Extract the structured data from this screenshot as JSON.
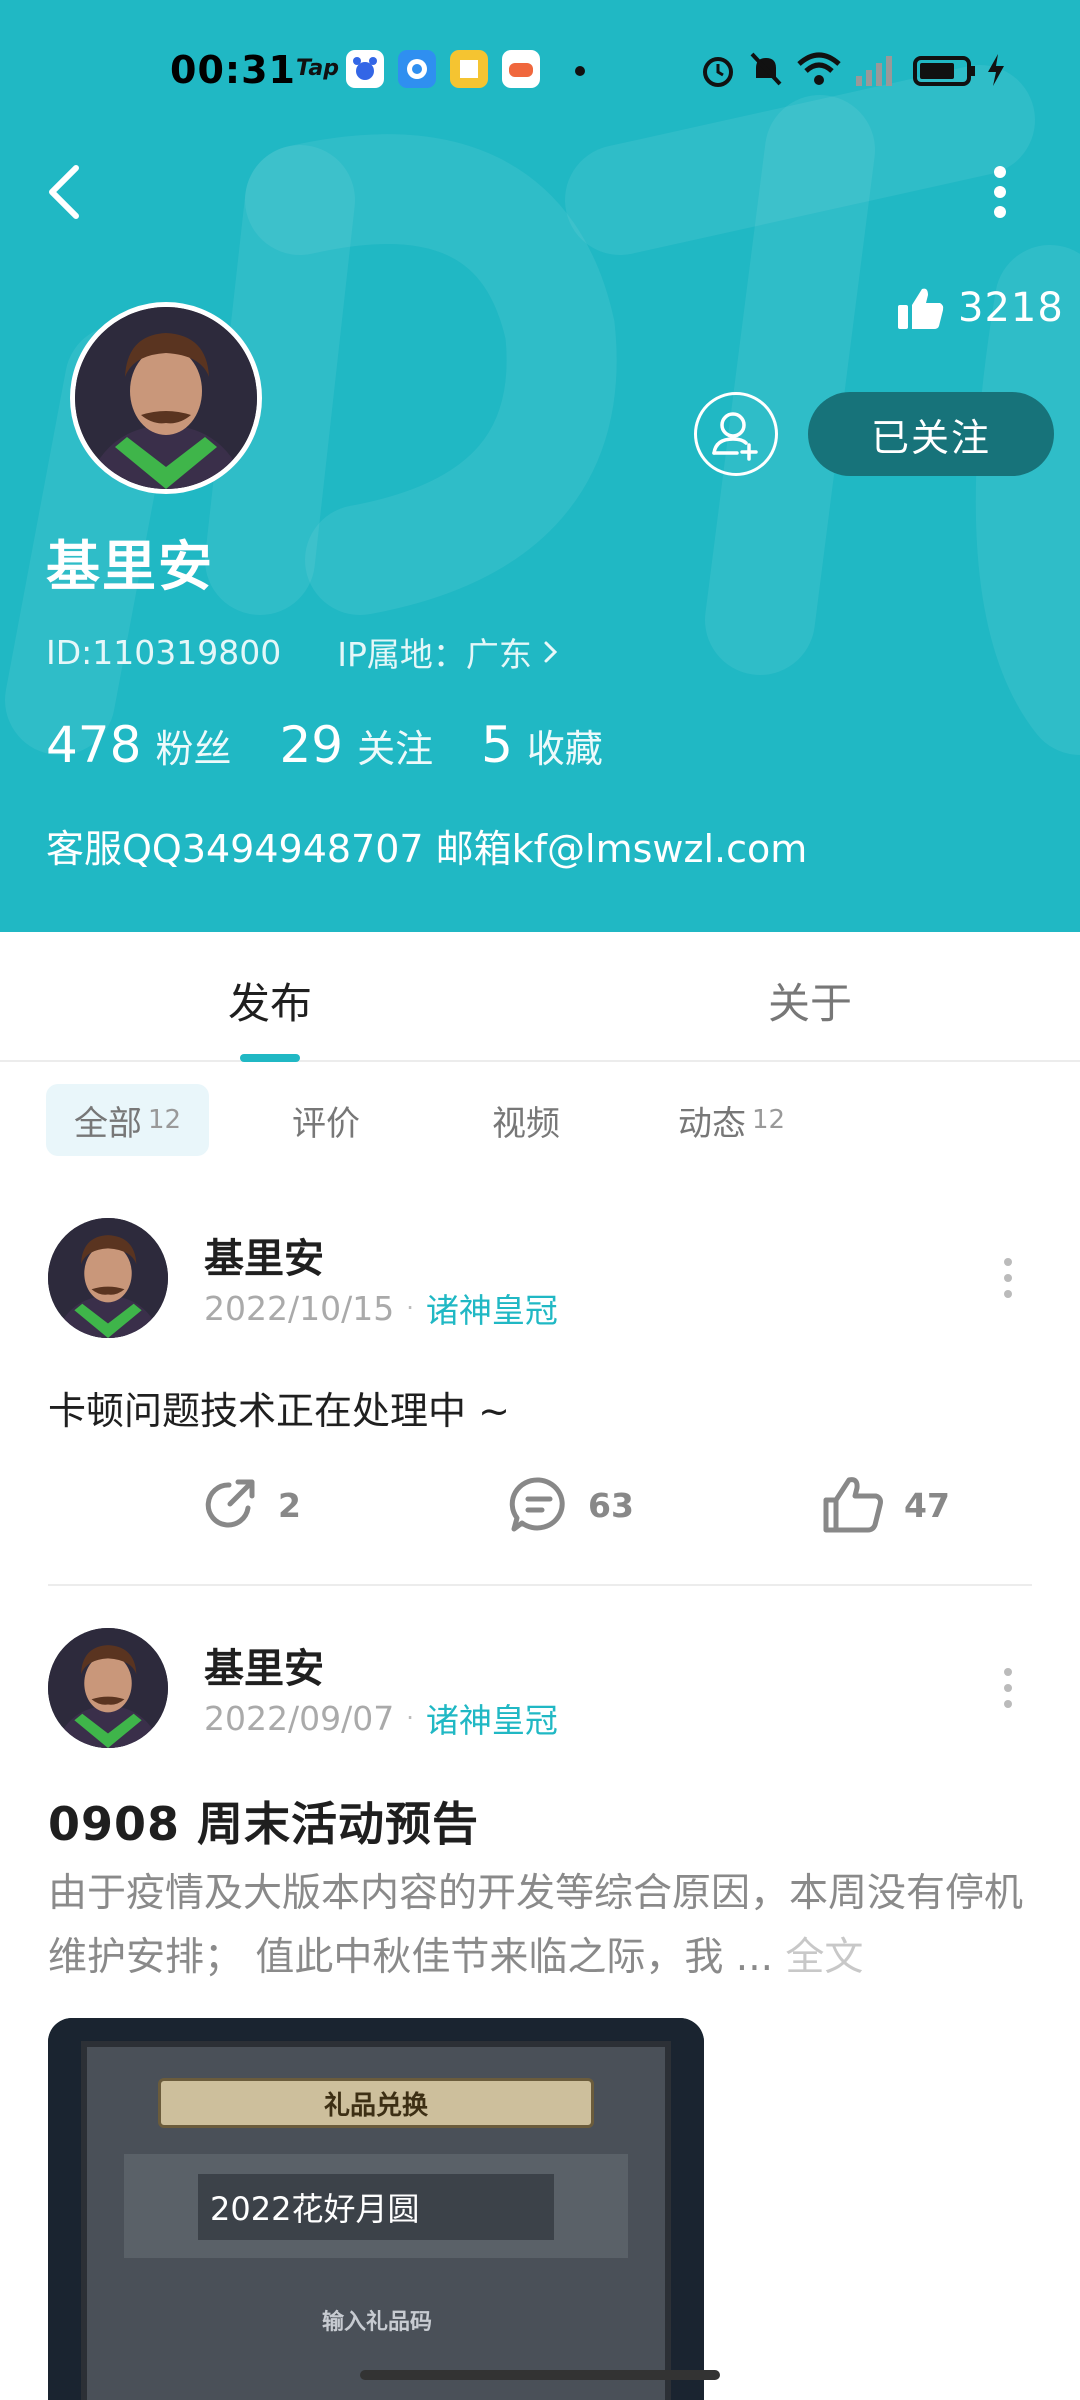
{
  "status_bar": {
    "time": "00:31",
    "tap_label": "Tap",
    "notification_icons": [
      "baidu-app-icon",
      "browser-app-icon",
      "reader-app-icon",
      "game-app-icon"
    ],
    "right_icons": [
      "alarm-icon",
      "mute-icon",
      "wifi-icon",
      "signal-icon",
      "battery-icon",
      "charging-icon"
    ]
  },
  "profile": {
    "likes_count": "3218",
    "follow_label": "已关注",
    "username": "基里安",
    "id_text": "ID:110319800",
    "ip_text": "IP属地：广东",
    "stats": [
      {
        "num": "478",
        "label": "粉丝"
      },
      {
        "num": "29",
        "label": "关注"
      },
      {
        "num": "5",
        "label": "收藏"
      }
    ],
    "bio": "客服QQ3494948707 邮箱kf@lmswzl.com"
  },
  "tabs": [
    {
      "label": "发布",
      "active": true
    },
    {
      "label": "关于",
      "active": false
    }
  ],
  "filters": [
    {
      "label": "全部",
      "count": "12",
      "active": true
    },
    {
      "label": "评价",
      "count": "",
      "active": false
    },
    {
      "label": "视频",
      "count": "",
      "active": false
    },
    {
      "label": "动态",
      "count": "12",
      "active": false
    }
  ],
  "posts": [
    {
      "author": "基里安",
      "date": "2022/10/15",
      "game": "诸神皇冠",
      "text": "卡顿问题技术正在处理中 ~",
      "reposts": "2",
      "comments": "63",
      "likes": "47"
    },
    {
      "author": "基里安",
      "date": "2022/09/07",
      "game": "诸神皇冠",
      "title": "0908 周末活动预告",
      "excerpt": "由于疫情及大版本内容的开发等综合原因，本周没有停机维护安排； 值此中秋佳节来临之际，我 ...",
      "full_text_link": "全文",
      "image": {
        "panel_title": "礼品兑换",
        "code_value": "2022花好月圆",
        "hint": "输入礼品码"
      }
    }
  ],
  "colors": {
    "brand": "#20b8c4",
    "follow_button": "#17737a"
  }
}
